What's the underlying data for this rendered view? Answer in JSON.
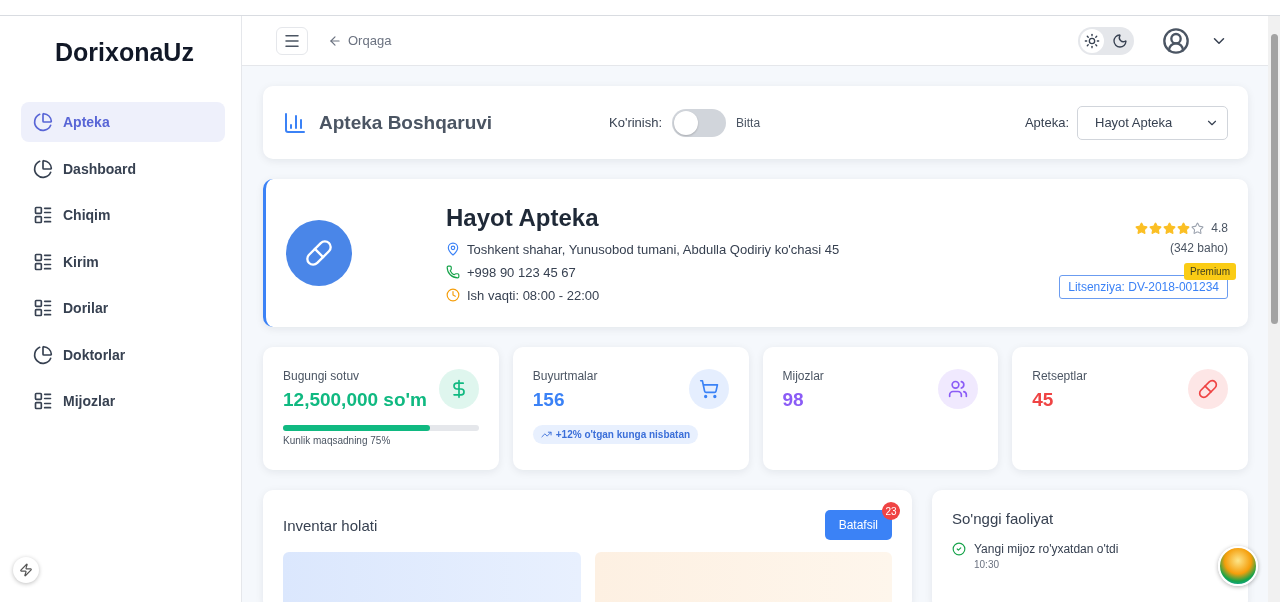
{
  "sidebar": {
    "brand": "DorixonaUz",
    "items": [
      {
        "label": "Apteka",
        "kind": "pie",
        "selected": true
      },
      {
        "label": "Dashboard",
        "kind": "pie",
        "selected": false
      },
      {
        "label": "Chiqim",
        "kind": "list",
        "selected": false
      },
      {
        "label": "Kirim",
        "kind": "list",
        "selected": false
      },
      {
        "label": "Dorilar",
        "kind": "list",
        "selected": false
      },
      {
        "label": "Doktorlar",
        "kind": "pie",
        "selected": false
      },
      {
        "label": "Mijozlar",
        "kind": "list",
        "selected": false
      }
    ]
  },
  "topbar": {
    "back": "Orqaga",
    "theme": [
      {
        "kind": "light",
        "selected": true
      },
      {
        "kind": "dark",
        "selected": false
      }
    ]
  },
  "header_card": {
    "title": "Apteka Boshqaruvi",
    "view_label": "Ko'rinish:",
    "view_toggle": {
      "on": false
    },
    "view_value": "Bitta",
    "pharmacy_label": "Apteka:",
    "pharmacy_select": "Hayot Apteka"
  },
  "profile": {
    "name": "Hayot Apteka",
    "details": [
      "Toshkent shahar, Yunusobod tumani, Abdulla Qodiriy ko'chasi 45",
      "+998 90 123 45 67",
      "Ish vaqti: 08:00 - 22:00"
    ],
    "stars": 4,
    "rating": "4.8",
    "reviews": "(342 baho)",
    "license": "Litsenziya: DV-2018-001234",
    "badge": "Premium"
  },
  "stats": [
    {
      "kind": "progress",
      "label": "Bugungi sotuv",
      "value": "12,500,000 so'm",
      "color": "#10b981",
      "level": 0.75,
      "caption": "Kunlik maqsadning 75%"
    },
    {
      "kind": "trend",
      "label": "Buyurtmalar",
      "value": "156",
      "color": "#3b82f6",
      "trend": "+12% o'tgan kunga nisbatan"
    },
    {
      "kind": "plain",
      "label": "Mijozlar",
      "value": "98",
      "color": "#8b5cf6"
    },
    {
      "kind": "plain",
      "label": "Retseptlar",
      "value": "45",
      "color": "#ef4444"
    }
  ],
  "inventory": {
    "title": "Inventar holati",
    "button": "Batafsil",
    "badge": "23"
  },
  "activity": {
    "title": "So'nggi faoliyat",
    "items": [
      {
        "text": "Yangi mijoz ro'yxatdan o'tdi",
        "time": "10:30"
      }
    ]
  }
}
